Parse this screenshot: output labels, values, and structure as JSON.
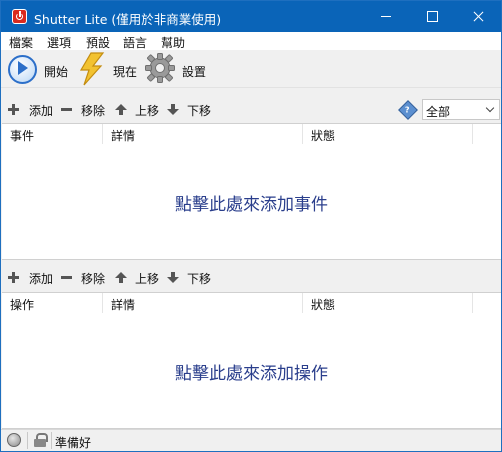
{
  "window": {
    "title": "Shutter Lite (僅用於非商業使用)"
  },
  "menu": [
    "檔案",
    "選項",
    "預設",
    "語言",
    "幫助"
  ],
  "toolbar": {
    "start_label": "開始",
    "now_label": "現在",
    "settings_label": "設置"
  },
  "events_toolbar": {
    "add_label": "添加",
    "remove_label": "移除",
    "up_label": "上移",
    "down_label": "下移",
    "filter_value": "全部"
  },
  "events_list": {
    "columns": [
      "事件",
      "詳情",
      "狀態"
    ],
    "empty_hint": "點擊此處來添加事件"
  },
  "actions_toolbar": {
    "add_label": "添加",
    "remove_label": "移除",
    "up_label": "上移",
    "down_label": "下移"
  },
  "actions_list": {
    "columns": [
      "操作",
      "詳情",
      "狀態"
    ],
    "empty_hint": "點擊此處來添加操作"
  },
  "status": {
    "text": "準備好"
  },
  "icons": [
    "app-power-icon",
    "play-icon",
    "lightning-icon",
    "gear-icon",
    "plus-icon",
    "minus-icon",
    "arrow-up-icon",
    "arrow-down-icon",
    "filter-icon",
    "globe-icon",
    "lock-icon"
  ],
  "colors": {
    "titlebar": "#0a64b8",
    "hint_text": "#2a3e8c",
    "play_accent": "#2c6fc9",
    "lightning": "#f2c230"
  }
}
